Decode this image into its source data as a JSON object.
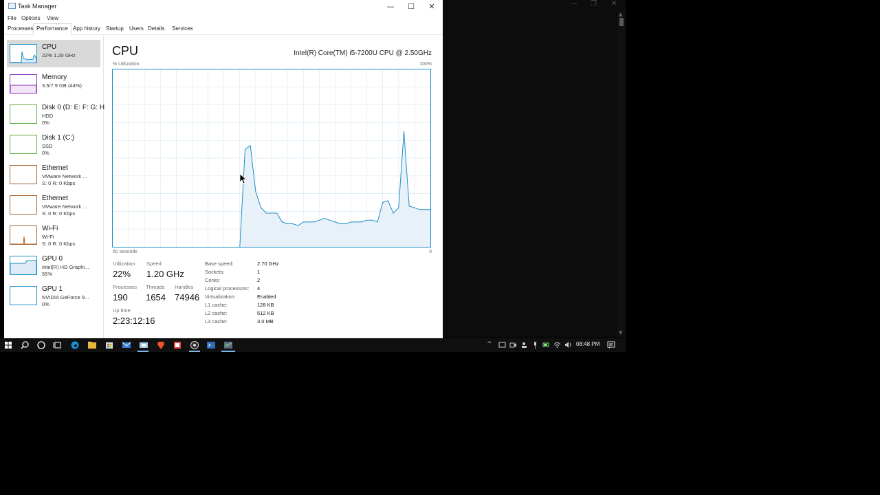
{
  "window": {
    "title": "Task Manager",
    "controls": [
      "—",
      "☐",
      "✕"
    ]
  },
  "menu": [
    "File",
    "Options",
    "View"
  ],
  "tabs": [
    "Processes",
    "Performance",
    "App history",
    "Startup",
    "Users",
    "Details",
    "Services"
  ],
  "active_tab": "Performance",
  "sidebar": [
    {
      "name": "CPU",
      "sub1": "22% 1.20 GHz",
      "sub2": "",
      "color": "#1c8fc9"
    },
    {
      "name": "Memory",
      "sub1": "3.5/7.9 GB (44%)",
      "sub2": "",
      "color": "#8b2fb4"
    },
    {
      "name": "Disk 0 (D: E: F: G: H",
      "sub1": "HDD",
      "sub2": "0%",
      "color": "#5aa93b"
    },
    {
      "name": "Disk 1 (C:)",
      "sub1": "SSD",
      "sub2": "0%",
      "color": "#5aa93b"
    },
    {
      "name": "Ethernet",
      "sub1": "VMware Network ...",
      "sub2": "S: 0 R: 0 Kbps",
      "color": "#a4612d"
    },
    {
      "name": "Ethernet",
      "sub1": "VMware Network ...",
      "sub2": "S: 0 R: 0 Kbps",
      "color": "#a4612d"
    },
    {
      "name": "Wi-Fi",
      "sub1": "Wi-Fi",
      "sub2": "S: 0 R: 0 Kbps",
      "color": "#a4612d"
    },
    {
      "name": "GPU 0",
      "sub1": "Intel(R) HD Graphi...",
      "sub2": "55%",
      "color": "#1c8fc9"
    },
    {
      "name": "GPU 1",
      "sub1": "NVIDIA GeForce 9...",
      "sub2": "0%",
      "color": "#1c8fc9"
    }
  ],
  "cpu": {
    "title": "CPU",
    "model": "Intel(R) Core(TM) i5-7200U CPU @ 2.50GHz",
    "y_label": "% Utilization",
    "y_max_label": "100%",
    "x_left_label": "60 seconds",
    "x_right_label": "0"
  },
  "chart_data": {
    "type": "area",
    "ylabel": "% Utilization",
    "ylim": [
      0,
      100
    ],
    "xlim": [
      60,
      0
    ],
    "x": [
      60,
      59,
      58,
      57,
      56,
      55,
      54,
      53,
      52,
      51,
      50,
      49,
      48,
      47,
      46,
      45,
      44,
      43,
      42,
      41,
      40,
      39,
      38,
      37,
      36,
      35,
      34,
      33,
      32,
      31,
      30,
      29,
      28,
      27,
      26,
      25,
      24,
      23,
      22,
      21,
      20,
      19,
      18,
      17,
      16,
      15,
      14,
      13,
      12,
      11,
      10,
      9,
      8,
      7,
      6,
      5,
      4,
      3,
      2,
      1,
      0
    ],
    "values": [
      0,
      0,
      0,
      0,
      0,
      0,
      0,
      0,
      0,
      0,
      0,
      0,
      0,
      0,
      0,
      0,
      0,
      0,
      0,
      0,
      0,
      0,
      0,
      0,
      0,
      55,
      57,
      31,
      22,
      19,
      19,
      19,
      14,
      13,
      13,
      12,
      14,
      14,
      14,
      15,
      16,
      15,
      14,
      13,
      13,
      14,
      14,
      14,
      15,
      15,
      14,
      25,
      26,
      19,
      22,
      65,
      23,
      22,
      21,
      21,
      21
    ]
  },
  "stats": {
    "utilization_label": "Utilization",
    "utilization": "22%",
    "speed_label": "Speed",
    "speed": "1.20 GHz",
    "processes_label": "Processes",
    "processes": "190",
    "threads_label": "Threads",
    "threads": "1654",
    "handles_label": "Handles",
    "handles": "74946",
    "uptime_label": "Up time",
    "uptime": "2:23:12:16"
  },
  "details": [
    {
      "k": "Base speed:",
      "v": "2.70 GHz"
    },
    {
      "k": "Sockets:",
      "v": "1"
    },
    {
      "k": "Cores:",
      "v": "2"
    },
    {
      "k": "Logical processors:",
      "v": "4"
    },
    {
      "k": "Virtualization:",
      "v": "Enabled"
    },
    {
      "k": "L1 cache:",
      "v": "128 KB"
    },
    {
      "k": "L2 cache:",
      "v": "512 KB"
    },
    {
      "k": "L3 cache:",
      "v": "3.0 MB"
    }
  ],
  "taskbar": {
    "clock": "08:48 PM",
    "apps": [
      "start-icon",
      "search-icon",
      "cortana-icon",
      "task-view-icon",
      "edge-icon",
      "file-explorer-icon",
      "store-icon",
      "mail-icon",
      "app-icon",
      "brave-icon",
      "app-icon",
      "chrome-icon",
      "terminal-icon",
      "task-manager-icon"
    ]
  },
  "bg_window": {
    "controls": [
      "—",
      "❐",
      "✕"
    ]
  }
}
